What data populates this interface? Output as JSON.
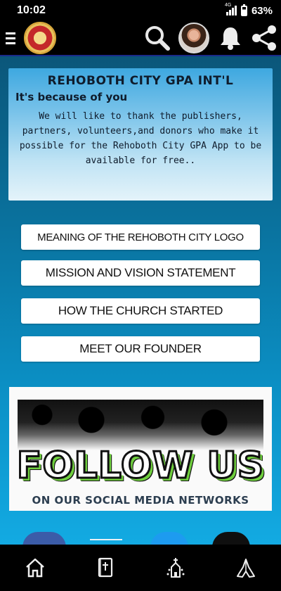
{
  "status_bar": {
    "time": "10:02",
    "network": "4G",
    "battery": "63%"
  },
  "app_bar": {
    "menu_icon": "hamburger-icon",
    "logo": "church-logo",
    "actions": [
      "search-icon",
      "profile-avatar",
      "bell-icon",
      "share-icon"
    ]
  },
  "banner": {
    "title": "REHOBOTH CITY GPA INT'L",
    "subtitle": "It's because of you",
    "body": "We will like to thank the publishers, partners, volunteers,and donors who make it possible for the Rehoboth City GPA App to be available for free.."
  },
  "menu": {
    "logo_meaning": "MEANING OF THE REHOBOTH CITY LOGO",
    "mission_vision": "MISSION AND VISION STATEMENT",
    "church_started": "HOW THE CHURCH STARTED",
    "meet_founder": "MEET OUR FOUNDER"
  },
  "follow_card": {
    "headline": "FOLLOW US",
    "subline": "ON OUR SOCIAL MEDIA NETWORKS"
  },
  "bottom_nav": [
    "home-icon",
    "bible-icon",
    "church-icon",
    "praying-hands-icon"
  ],
  "colors": {
    "accent_green": "#6fcf3e",
    "bar_black": "#000000",
    "facebook_blue": "#3b5ca8",
    "twitter_blue": "#1d9bf0"
  }
}
